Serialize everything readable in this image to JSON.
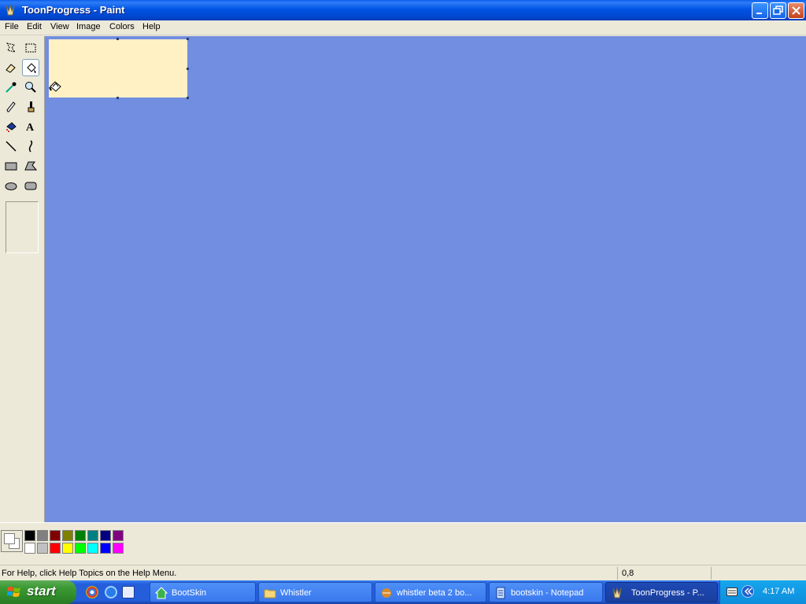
{
  "window": {
    "title": "ToonProgress - Paint"
  },
  "menu": {
    "items": [
      "File",
      "Edit",
      "View",
      "Image",
      "Colors",
      "Help"
    ]
  },
  "tools": [
    "free-form-select",
    "select",
    "eraser",
    "fill-with-color",
    "pick-color",
    "magnifier",
    "pencil",
    "brush",
    "airbrush",
    "text",
    "line",
    "curve",
    "rectangle",
    "polygon",
    "ellipse",
    "rounded-rectangle"
  ],
  "selected_tool": "fill-with-color",
  "canvas": {
    "color": "#fff1c4",
    "workspace_color": "#728ee0"
  },
  "palette": {
    "top": [
      "#000000",
      "#808080",
      "#800000",
      "#808000",
      "#008000",
      "#008080",
      "#000080",
      "#800080"
    ],
    "bottom": [
      "#ffffff",
      "#c0c0c0",
      "#ff0000",
      "#ffff00",
      "#00ff00",
      "#00ffff",
      "#0000ff",
      "#ff00ff"
    ]
  },
  "status": {
    "help": "For Help, click Help Topics on the Help Menu.",
    "coords": "0,8"
  },
  "taskbar": {
    "start_label": "start",
    "tasks": [
      {
        "label": "BootSkin",
        "icon": "house-icon"
      },
      {
        "label": "Whistler",
        "icon": "folder-icon"
      },
      {
        "label": "whistler beta 2 bo...",
        "icon": "browser-icon"
      },
      {
        "label": "bootskin - Notepad",
        "icon": "notepad-icon"
      },
      {
        "label": "ToonProgress - P...",
        "icon": "paint-icon"
      }
    ],
    "clock": "4:17 AM"
  }
}
